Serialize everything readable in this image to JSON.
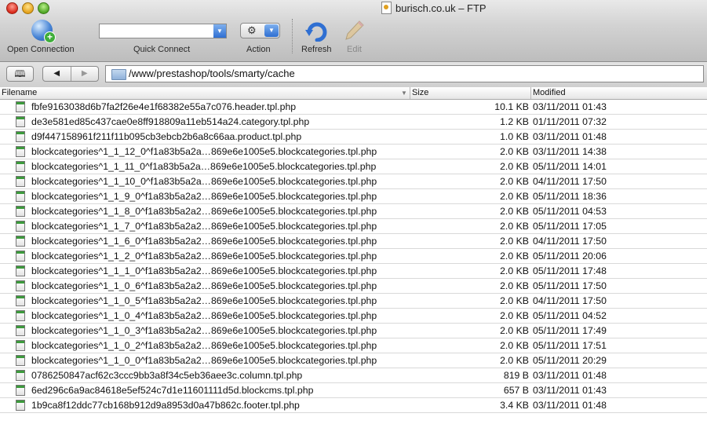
{
  "window": {
    "title": "burisch.co.uk – FTP"
  },
  "toolbar": {
    "open_connection": "Open Connection",
    "quick_connect": "Quick Connect",
    "action": "Action",
    "refresh": "Refresh",
    "edit": "Edit"
  },
  "path": {
    "current": "/www/prestashop/tools/smarty/cache"
  },
  "columns": {
    "filename": "Filename",
    "size": "Size",
    "modified": "Modified"
  },
  "files": [
    {
      "name": "fbfe9163038d6b7fa2f26e4e1f68382e55a7c076.header.tpl.php",
      "size": "10.1 KB",
      "modified": "03/11/2011 01:43"
    },
    {
      "name": "de3e581ed85c437cae0e8ff918809a11eb514a24.category.tpl.php",
      "size": "1.2 KB",
      "modified": "01/11/2011 07:32"
    },
    {
      "name": "d9f447158961f211f11b095cb3ebcb2b6a8c66aa.product.tpl.php",
      "size": "1.0 KB",
      "modified": "03/11/2011 01:48"
    },
    {
      "name": "blockcategories^1_1_12_0^f1a83b5a2a…869e6e1005e5.blockcategories.tpl.php",
      "size": "2.0 KB",
      "modified": "03/11/2011 14:38"
    },
    {
      "name": "blockcategories^1_1_11_0^f1a83b5a2a…869e6e1005e5.blockcategories.tpl.php",
      "size": "2.0 KB",
      "modified": "05/11/2011 14:01"
    },
    {
      "name": "blockcategories^1_1_10_0^f1a83b5a2a…869e6e1005e5.blockcategories.tpl.php",
      "size": "2.0 KB",
      "modified": "04/11/2011 17:50"
    },
    {
      "name": "blockcategories^1_1_9_0^f1a83b5a2a2…869e6e1005e5.blockcategories.tpl.php",
      "size": "2.0 KB",
      "modified": "05/11/2011 18:36"
    },
    {
      "name": "blockcategories^1_1_8_0^f1a83b5a2a2…869e6e1005e5.blockcategories.tpl.php",
      "size": "2.0 KB",
      "modified": "05/11/2011 04:53"
    },
    {
      "name": "blockcategories^1_1_7_0^f1a83b5a2a2…869e6e1005e5.blockcategories.tpl.php",
      "size": "2.0 KB",
      "modified": "05/11/2011 17:05"
    },
    {
      "name": "blockcategories^1_1_6_0^f1a83b5a2a2…869e6e1005e5.blockcategories.tpl.php",
      "size": "2.0 KB",
      "modified": "04/11/2011 17:50"
    },
    {
      "name": "blockcategories^1_1_2_0^f1a83b5a2a2…869e6e1005e5.blockcategories.tpl.php",
      "size": "2.0 KB",
      "modified": "05/11/2011 20:06"
    },
    {
      "name": "blockcategories^1_1_1_0^f1a83b5a2a2…869e6e1005e5.blockcategories.tpl.php",
      "size": "2.0 KB",
      "modified": "05/11/2011 17:48"
    },
    {
      "name": "blockcategories^1_1_0_6^f1a83b5a2a2…869e6e1005e5.blockcategories.tpl.php",
      "size": "2.0 KB",
      "modified": "05/11/2011 17:50"
    },
    {
      "name": "blockcategories^1_1_0_5^f1a83b5a2a2…869e6e1005e5.blockcategories.tpl.php",
      "size": "2.0 KB",
      "modified": "04/11/2011 17:50"
    },
    {
      "name": "blockcategories^1_1_0_4^f1a83b5a2a2…869e6e1005e5.blockcategories.tpl.php",
      "size": "2.0 KB",
      "modified": "05/11/2011 04:52"
    },
    {
      "name": "blockcategories^1_1_0_3^f1a83b5a2a2…869e6e1005e5.blockcategories.tpl.php",
      "size": "2.0 KB",
      "modified": "05/11/2011 17:49"
    },
    {
      "name": "blockcategories^1_1_0_2^f1a83b5a2a2…869e6e1005e5.blockcategories.tpl.php",
      "size": "2.0 KB",
      "modified": "05/11/2011 17:51"
    },
    {
      "name": "blockcategories^1_1_0_0^f1a83b5a2a2…869e6e1005e5.blockcategories.tpl.php",
      "size": "2.0 KB",
      "modified": "05/11/2011 20:29"
    },
    {
      "name": "0786250847acf62c3ccc9bb3a8f34c5eb36aee3c.column.tpl.php",
      "size": "819 B",
      "modified": "03/11/2011 01:48"
    },
    {
      "name": "6ed296c6a9ac84618e5ef524c7d1e11601111d5d.blockcms.tpl.php",
      "size": "657 B",
      "modified": "03/11/2011 01:43"
    },
    {
      "name": "1b9ca8f12ddc77cb168b912d9a8953d0a47b862c.footer.tpl.php",
      "size": "3.4 KB",
      "modified": "03/11/2011 01:48"
    }
  ]
}
